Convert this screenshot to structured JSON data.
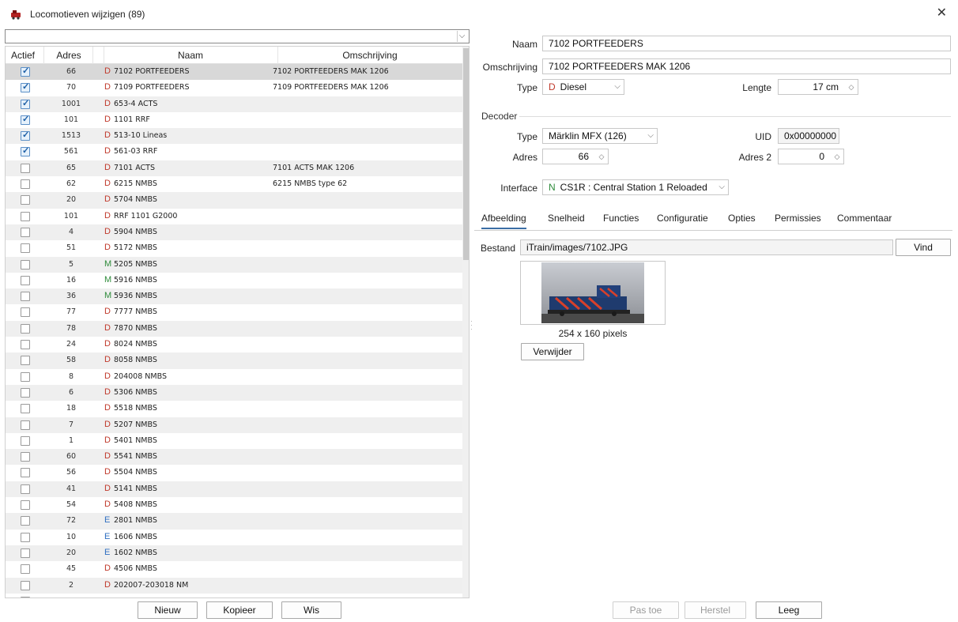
{
  "window": {
    "title": "Locomotieven wijzigen (89)"
  },
  "list": {
    "headers": {
      "actief": "Actief",
      "adres": "Adres",
      "naam": "Naam",
      "omschrijving": "Omschrijving"
    },
    "rows": [
      {
        "active": true,
        "adres": "66",
        "type": "D",
        "naam": "7102 PORTFEEDERS",
        "omschrijving": "7102 PORTFEEDERS MAK 1206",
        "selected": true
      },
      {
        "active": true,
        "adres": "70",
        "type": "D",
        "naam": "7109 PORTFEEDERS",
        "omschrijving": "7109 PORTFEEDERS MAK 1206"
      },
      {
        "active": true,
        "adres": "1001",
        "type": "D",
        "naam": "653-4 ACTS",
        "omschrijving": ""
      },
      {
        "active": true,
        "adres": "101",
        "type": "D",
        "naam": "1101 RRF",
        "omschrijving": ""
      },
      {
        "active": true,
        "adres": "1513",
        "type": "D",
        "naam": "513-10 Lineas",
        "omschrijving": ""
      },
      {
        "active": true,
        "adres": "561",
        "type": "D",
        "naam": "561-03 RRF",
        "omschrijving": ""
      },
      {
        "active": false,
        "adres": "65",
        "type": "D",
        "naam": "7101 ACTS",
        "omschrijving": "7101 ACTS MAK 1206"
      },
      {
        "active": false,
        "adres": "62",
        "type": "D",
        "naam": "6215 NMBS",
        "omschrijving": "6215 NMBS type 62"
      },
      {
        "active": false,
        "adres": "20",
        "type": "D",
        "naam": "5704 NMBS",
        "omschrijving": ""
      },
      {
        "active": false,
        "adres": "101",
        "type": "D",
        "naam": "RRF 1101 G2000",
        "omschrijving": ""
      },
      {
        "active": false,
        "adres": "4",
        "type": "D",
        "naam": "5904 NMBS",
        "omschrijving": ""
      },
      {
        "active": false,
        "adres": "51",
        "type": "D",
        "naam": "5172 NMBS",
        "omschrijving": ""
      },
      {
        "active": false,
        "adres": "5",
        "type": "M",
        "naam": "5205 NMBS",
        "omschrijving": ""
      },
      {
        "active": false,
        "adres": "16",
        "type": "M",
        "naam": "5916 NMBS",
        "omschrijving": ""
      },
      {
        "active": false,
        "adres": "36",
        "type": "M",
        "naam": "5936 NMBS",
        "omschrijving": ""
      },
      {
        "active": false,
        "adres": "77",
        "type": "D",
        "naam": "7777 NMBS",
        "omschrijving": ""
      },
      {
        "active": false,
        "adres": "78",
        "type": "D",
        "naam": "7870 NMBS",
        "omschrijving": ""
      },
      {
        "active": false,
        "adres": "24",
        "type": "D",
        "naam": "8024 NMBS",
        "omschrijving": ""
      },
      {
        "active": false,
        "adres": "58",
        "type": "D",
        "naam": "8058 NMBS",
        "omschrijving": ""
      },
      {
        "active": false,
        "adres": "8",
        "type": "D",
        "naam": "204008 NMBS",
        "omschrijving": ""
      },
      {
        "active": false,
        "adres": "6",
        "type": "D",
        "naam": "5306 NMBS",
        "omschrijving": ""
      },
      {
        "active": false,
        "adres": "18",
        "type": "D",
        "naam": "5518 NMBS",
        "omschrijving": ""
      },
      {
        "active": false,
        "adres": "7",
        "type": "D",
        "naam": "5207 NMBS",
        "omschrijving": ""
      },
      {
        "active": false,
        "adres": "1",
        "type": "D",
        "naam": "5401 NMBS",
        "omschrijving": ""
      },
      {
        "active": false,
        "adres": "60",
        "type": "D",
        "naam": "5541 NMBS",
        "omschrijving": ""
      },
      {
        "active": false,
        "adres": "56",
        "type": "D",
        "naam": "5504 NMBS",
        "omschrijving": ""
      },
      {
        "active": false,
        "adres": "41",
        "type": "D",
        "naam": "5141 NMBS",
        "omschrijving": ""
      },
      {
        "active": false,
        "adres": "54",
        "type": "D",
        "naam": "5408 NMBS",
        "omschrijving": ""
      },
      {
        "active": false,
        "adres": "72",
        "type": "E",
        "naam": "2801 NMBS",
        "omschrijving": ""
      },
      {
        "active": false,
        "adres": "10",
        "type": "E",
        "naam": "1606 NMBS",
        "omschrijving": ""
      },
      {
        "active": false,
        "adres": "20",
        "type": "E",
        "naam": "1602 NMBS",
        "omschrijving": ""
      },
      {
        "active": false,
        "adres": "45",
        "type": "D",
        "naam": "4506 NMBS",
        "omschrijving": ""
      },
      {
        "active": false,
        "adres": "2",
        "type": "D",
        "naam": "202007-203018 NM",
        "omschrijving": ""
      },
      {
        "active": false,
        "adres": "",
        "type": "",
        "naam": "",
        "omschrijving": ""
      }
    ],
    "type_colors": {
      "D": "#c0392b",
      "M": "#2e8b3a",
      "E": "#2f6fc1",
      "N": "#2e8b3a"
    }
  },
  "left_buttons": {
    "nieuw": "Nieuw",
    "kopieer": "Kopieer",
    "wis": "Wis"
  },
  "form": {
    "naam_label": "Naam",
    "naam": "7102 PORTFEEDERS",
    "omschrijving_label": "Omschrijving",
    "omschrijving": "7102 PORTFEEDERS MAK 1206",
    "type_label": "Type",
    "type_prefix": "D",
    "type_value": "Diesel",
    "lengte_label": "Lengte",
    "lengte_value": "17 cm"
  },
  "decoder": {
    "section_label": "Decoder",
    "type_label": "Type",
    "type_value": "Märklin MFX (126)",
    "uid_label": "UID",
    "uid_value": "0x00000000",
    "adres_label": "Adres",
    "adres_value": "66",
    "adres2_label": "Adres 2",
    "adres2_value": "0",
    "interface_label": "Interface",
    "interface_prefix": "N",
    "interface_value": "CS1R : Central Station 1 Reloaded"
  },
  "tabs": [
    "Afbeelding",
    "Snelheid",
    "Functies",
    "Configuratie",
    "Opties",
    "Permissies",
    "Commentaar"
  ],
  "image_tab": {
    "bestand_label": "Bestand",
    "bestand_value": "iTrain/images/7102.JPG",
    "vind": "Vind",
    "caption": "254 x 160 pixels",
    "verwijder": "Verwijder"
  },
  "bottom_buttons": {
    "pas_toe": "Pas toe",
    "herstel": "Herstel",
    "leeg": "Leeg"
  }
}
